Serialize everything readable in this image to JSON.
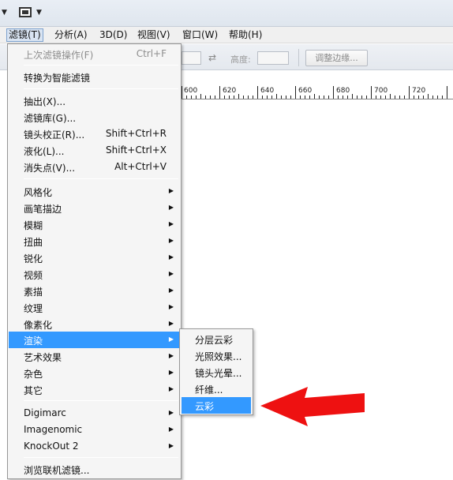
{
  "colors": {
    "highlight": "#3399ff",
    "arrow": "#ee1111",
    "menu_background": "#f5f5f5"
  },
  "menubar": {
    "items": [
      {
        "label": "滤镜(T)"
      },
      {
        "label": "分析(A)"
      },
      {
        "label": "3D(D)"
      },
      {
        "label": "视图(V)"
      },
      {
        "label": "窗口(W)"
      },
      {
        "label": "帮助(H)"
      }
    ],
    "active_index": 0
  },
  "options_bar": {
    "height_label": "高度:",
    "refine_button": "调整边缘..."
  },
  "ruler": {
    "labels": [
      "600",
      "620",
      "640",
      "660",
      "680",
      "700",
      "720"
    ]
  },
  "filter_menu": {
    "last_filter": {
      "label": "上次滤镜操作(F)",
      "shortcut": "Ctrl+F",
      "disabled": true
    },
    "smart_filter": {
      "label": "转换为智能滤镜"
    },
    "group_a": [
      {
        "label": "抽出(X)...",
        "shortcut": ""
      },
      {
        "label": "滤镜库(G)...",
        "shortcut": ""
      },
      {
        "label": "镜头校正(R)...",
        "shortcut": "Shift+Ctrl+R"
      },
      {
        "label": "液化(L)...",
        "shortcut": "Shift+Ctrl+X"
      },
      {
        "label": "消失点(V)...",
        "shortcut": "Alt+Ctrl+V"
      }
    ],
    "group_b": [
      {
        "label": "风格化"
      },
      {
        "label": "画笔描边"
      },
      {
        "label": "模糊"
      },
      {
        "label": "扭曲"
      },
      {
        "label": "锐化"
      },
      {
        "label": "视频"
      },
      {
        "label": "素描"
      },
      {
        "label": "纹理"
      },
      {
        "label": "像素化"
      },
      {
        "label": "渲染"
      },
      {
        "label": "艺术效果"
      },
      {
        "label": "杂色"
      },
      {
        "label": "其它"
      }
    ],
    "highlighted": "渲染",
    "group_c": [
      {
        "label": "Digimarc"
      },
      {
        "label": "Imagenomic"
      },
      {
        "label": "KnockOut 2"
      }
    ],
    "browse": {
      "label": "浏览联机滤镜..."
    }
  },
  "render_submenu": {
    "items": [
      {
        "label": "分层云彩"
      },
      {
        "label": "光照效果..."
      },
      {
        "label": "镜头光晕..."
      },
      {
        "label": "纤维..."
      },
      {
        "label": "云彩"
      }
    ],
    "highlighted_index": 4
  },
  "icons": {
    "submenu_arrow": "▶",
    "toolbar_arrow": "▼",
    "swap": "⇄"
  }
}
